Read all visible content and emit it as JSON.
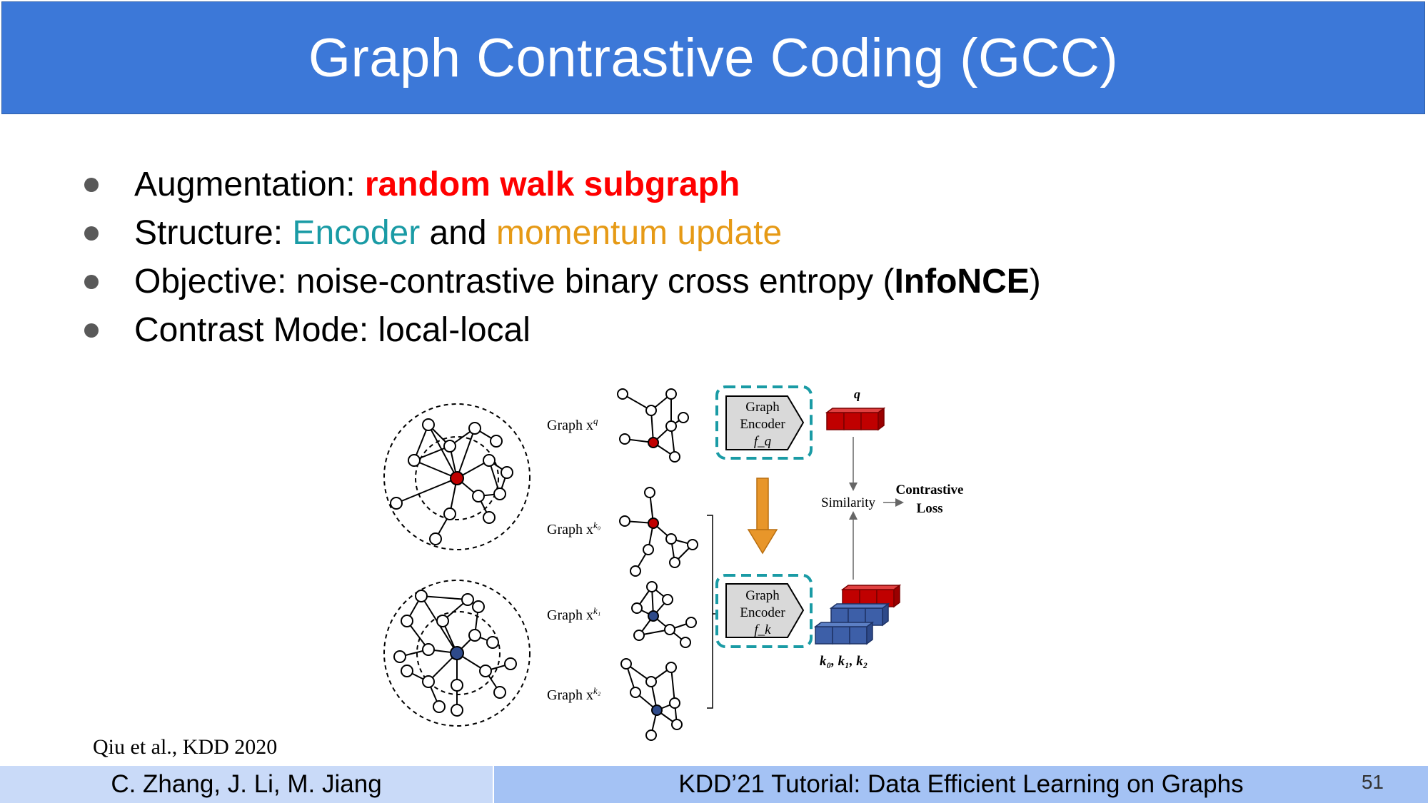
{
  "slide": {
    "title": "Graph Contrastive Coding (GCC)",
    "bullets": [
      {
        "label": "Augmentation: ",
        "highlight": "random walk subgraph"
      },
      {
        "label": "Structure: ",
        "part1": "Encoder",
        "mid": " and ",
        "part2": "momentum update"
      },
      {
        "label": "Objective: noise-contrastive binary cross entropy (",
        "bold": "InfoNCE",
        "end": ")"
      },
      {
        "label": "Contrast Mode: local-local"
      }
    ],
    "citation": "Qiu et al., KDD 2020",
    "footer_left": "C. Zhang, J. Li, M. Jiang",
    "footer_right": "KDD’21 Tutorial: Data Efficient Learning on Graphs",
    "page_number": "51"
  },
  "figure": {
    "graph_labels": [
      "Graph x",
      "Graph x",
      "Graph x",
      "Graph x"
    ],
    "graph_sups": [
      "q",
      "k₀",
      "k₁",
      "k₂"
    ],
    "encoder_q": {
      "line1": "Graph",
      "line2": "Encoder",
      "line3": "f_q"
    },
    "encoder_k": {
      "line1": "Graph",
      "line2": "Encoder",
      "line3": "f_k"
    },
    "q_label": "q",
    "k_label": "k₀, k₁, k₂",
    "similarity": "Similarity",
    "contrastive": "Contrastive",
    "loss": "Loss",
    "colors": {
      "red_node": "#c00000",
      "blue_node": "#2e4a8a",
      "teal_dash": "#1a9ba5",
      "arrow": "#e8962a"
    }
  }
}
